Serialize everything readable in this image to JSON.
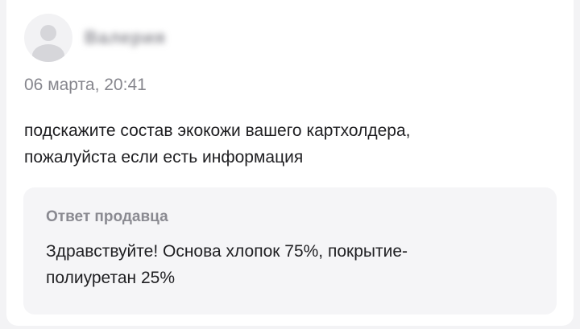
{
  "review": {
    "author_name": "Валерия",
    "date": "06 марта, 20:41",
    "text_line1": "подскажите состав экокожи вашего картхолдера,",
    "text_line2": "пожалуйста если есть информация"
  },
  "seller_answer": {
    "title": "Ответ продавца",
    "text_line1": "Здравствуйте! Основа хлопок 75%, покрытие-",
    "text_line2": "полиуретан 25%"
  },
  "icons": {
    "avatar": "user-avatar-icon"
  },
  "colors": {
    "page_background": "#f3f3f5",
    "card_background": "#ffffff",
    "answer_background": "#f5f5f7",
    "muted_text": "#86868d",
    "main_text": "#1f1f22"
  }
}
